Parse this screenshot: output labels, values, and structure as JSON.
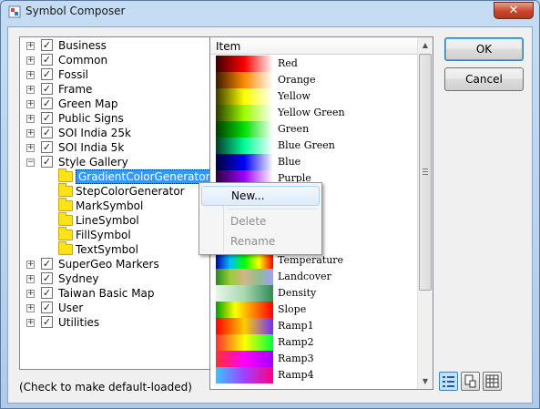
{
  "window": {
    "title": "Symbol Composer",
    "close_label": "✕"
  },
  "tree": {
    "items": [
      {
        "label": "Business",
        "expander": "+",
        "checked": true
      },
      {
        "label": "Common",
        "expander": "+",
        "checked": true
      },
      {
        "label": "Fossil",
        "expander": "+",
        "checked": true
      },
      {
        "label": "Frame",
        "expander": "+",
        "checked": true
      },
      {
        "label": "Green Map",
        "expander": "+",
        "checked": true
      },
      {
        "label": "Public Signs",
        "expander": "+",
        "checked": true
      },
      {
        "label": "SOI India 25k",
        "expander": "+",
        "checked": true
      },
      {
        "label": "SOI India 5k",
        "expander": "+",
        "checked": true
      },
      {
        "label": "Style Gallery",
        "expander": "−",
        "checked": true
      },
      {
        "label": "SuperGeo Markers",
        "expander": "+",
        "checked": true
      },
      {
        "label": "Sydney",
        "expander": "+",
        "checked": true
      },
      {
        "label": "Taiwan Basic Map",
        "expander": "+",
        "checked": true
      },
      {
        "label": "User",
        "expander": "+",
        "checked": true
      },
      {
        "label": "Utilities",
        "expander": "+",
        "checked": true
      }
    ],
    "children": [
      {
        "label": "GradientColorGenerator",
        "selected": true
      },
      {
        "label": "StepColorGenerator"
      },
      {
        "label": "MarkSymbol"
      },
      {
        "label": "LineSymbol"
      },
      {
        "label": "FillSymbol"
      },
      {
        "label": "TextSymbol"
      }
    ],
    "check_mark": "✓"
  },
  "status_text": "(Check to make default-loaded)",
  "list": {
    "header": "Item",
    "items": [
      {
        "label": "Red",
        "gradient": "linear-gradient(90deg,#3a0000,#ff0000,#ffffff)"
      },
      {
        "label": "Orange",
        "gradient": "linear-gradient(90deg,#3a1a00,#ff8a00,#ffffff)"
      },
      {
        "label": "Yellow",
        "gradient": "linear-gradient(90deg,#3a3a00,#ffff00,#ffffff)"
      },
      {
        "label": "Yellow Green",
        "gradient": "linear-gradient(90deg,#2a3a00,#9aff00,#ffffff)"
      },
      {
        "label": "Green",
        "gradient": "linear-gradient(90deg,#003a00,#00e000,#ffffff)"
      },
      {
        "label": "Blue Green",
        "gradient": "linear-gradient(90deg,#003a2a,#00ff99,#ffffff)"
      },
      {
        "label": "Blue",
        "gradient": "linear-gradient(90deg,#00003a,#0000ff,#ffffff)"
      },
      {
        "label": "Purple",
        "gradient": "linear-gradient(90deg,#2a003a,#a000ff,#ffffff)"
      },
      {
        "label": "",
        "gradient": "linear-gradient(90deg,#3a0030,#ff00c0,#ffffff)"
      },
      {
        "label": "",
        "gradient": "linear-gradient(90deg,#0000ff,#00ffff,#00ff00,#ffff00,#ff0000)"
      },
      {
        "label": "",
        "gradient": "linear-gradient(90deg,#8b4513,#deb887,#f5f5dc)"
      },
      {
        "label": "",
        "gradient": "linear-gradient(90deg,#ff0000,#ffff00,#00ff00,#0000ff)"
      },
      {
        "label": "Temperature",
        "gradient": "linear-gradient(90deg,#0000aa,#00c0ff,#00ff00,#ffff00,#ff0000)"
      },
      {
        "label": "Landcover",
        "gradient": "linear-gradient(90deg,#228b22,#9acd32,#d2b48c,#8fbc8f,#a0a0ff)"
      },
      {
        "label": "Density",
        "gradient": "linear-gradient(90deg,#e8f5e8,#a8d8b0,#2e8b57)"
      },
      {
        "label": "Slope",
        "gradient": "linear-gradient(90deg,#00a000,#ffff00,#ff8000,#ff0000)"
      },
      {
        "label": "Ramp1",
        "gradient": "linear-gradient(90deg,#ff0000,#ffcc00,#7030ff)"
      },
      {
        "label": "Ramp2",
        "gradient": "linear-gradient(90deg,#ff3030,#ffff00,#00ff40)"
      },
      {
        "label": "Ramp3",
        "gradient": "linear-gradient(90deg,#ff3030,#ff00ff,#a000ff)"
      },
      {
        "label": "Ramp4",
        "gradient": "linear-gradient(90deg,#40c0ff,#a040ff,#ff0080)"
      }
    ]
  },
  "context_menu": {
    "items": [
      {
        "label": "New...",
        "enabled": true
      },
      {
        "label": "Delete",
        "enabled": false
      },
      {
        "label": "Rename",
        "enabled": false
      }
    ]
  },
  "buttons": {
    "ok": "OK",
    "cancel": "Cancel"
  },
  "scroll": {
    "up": "▲",
    "down": "▼"
  }
}
